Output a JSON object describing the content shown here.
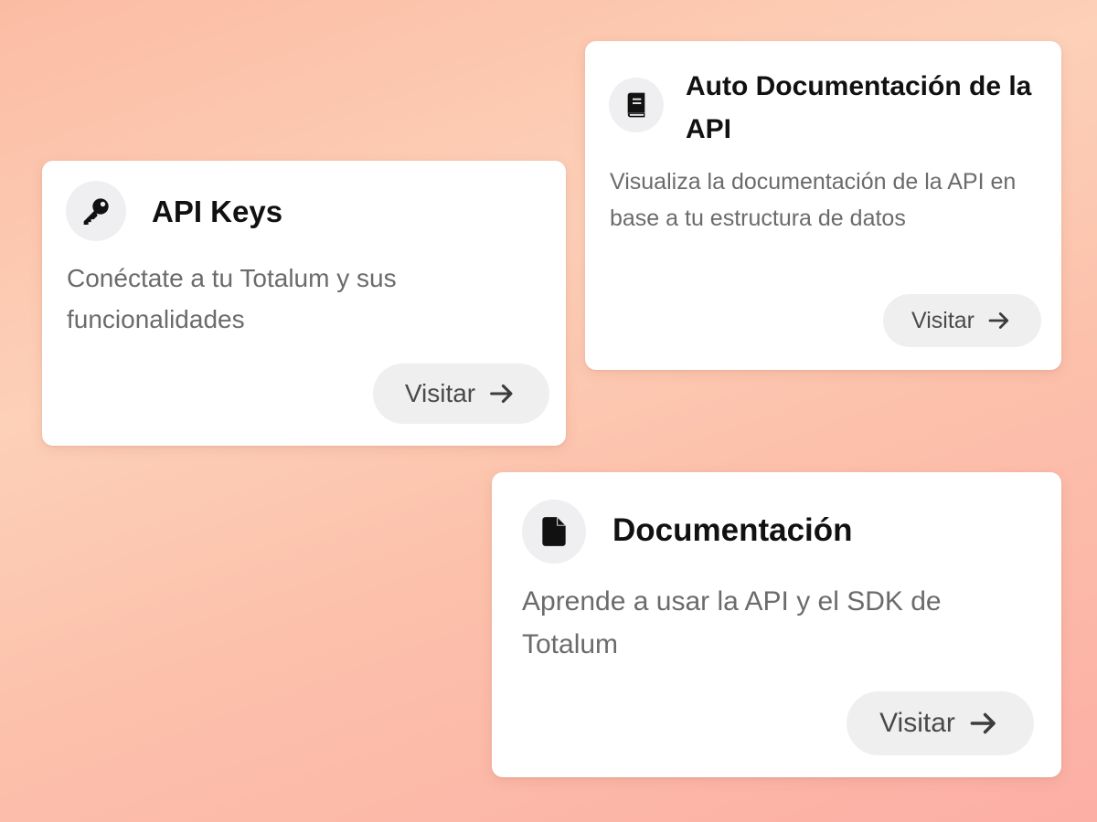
{
  "cards": {
    "api_keys": {
      "icon": "key-icon",
      "title": "API Keys",
      "description": "Conéctate a tu Totalum y sus funcionalidades",
      "button_label": "Visitar"
    },
    "auto_documentation": {
      "icon": "book-icon",
      "title": "Auto Documentación de la API",
      "description": "Visualiza la documentación de la API en base a tu estructura de datos",
      "button_label": "Visitar"
    },
    "documentation": {
      "icon": "file-icon",
      "title": "Documentación",
      "description": "Aprende a usar la API y el SDK de Totalum",
      "button_label": "Visitar"
    }
  },
  "colors": {
    "background_gradient_start": "#fcbca4",
    "background_gradient_end": "#fcafa5",
    "card_background": "#ffffff",
    "icon_circle": "#efeff1",
    "button_background": "#efefef",
    "title_text": "#111111",
    "description_text": "#6b6b6b"
  }
}
